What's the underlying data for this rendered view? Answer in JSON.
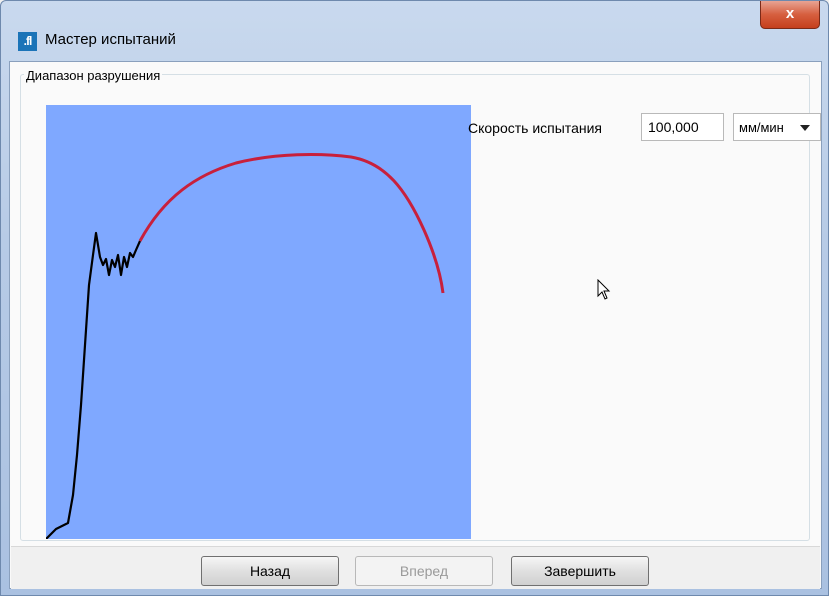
{
  "window": {
    "title": "Мастер испытаний",
    "app_icon_text": ".fl",
    "close_label": "x"
  },
  "group": {
    "title": "Диапазон разрушения"
  },
  "speed": {
    "label": "Скорость испытания",
    "value": "100,000",
    "unit": "мм/мин"
  },
  "buttons": {
    "back": "Назад",
    "next": "Вперед",
    "finish": "Завершить"
  },
  "colors": {
    "plot_bg": "#7fa8ff",
    "curve_initial": "#000000",
    "curve_break_range": "#c8203c"
  }
}
